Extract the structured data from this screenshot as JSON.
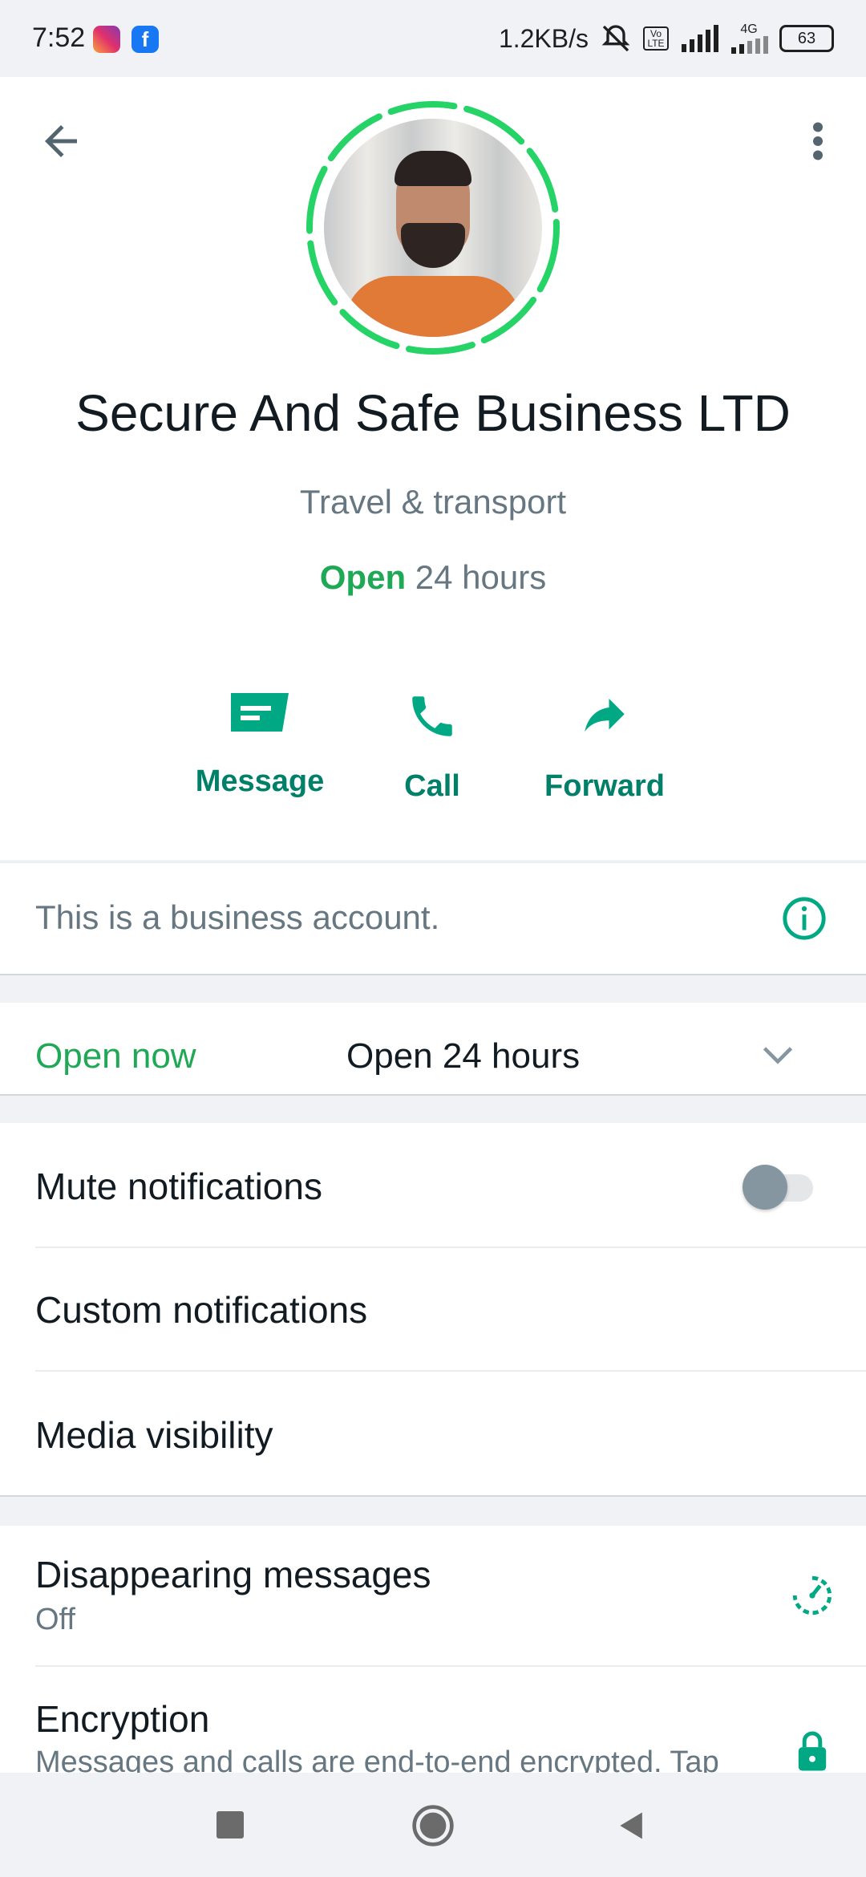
{
  "status_bar": {
    "time": "7:52",
    "net_speed": "1.2KB/s",
    "network": "4G",
    "volte": "Vo LTE",
    "battery": "63"
  },
  "profile": {
    "name": "Secure And Safe Business LTD",
    "category": "Travel & transport",
    "hours_status": "Open",
    "hours_detail": "24 hours"
  },
  "actions": [
    {
      "label": "Message",
      "icon": "message-icon"
    },
    {
      "label": "Call",
      "icon": "call-icon"
    },
    {
      "label": "Forward",
      "icon": "forward-icon"
    }
  ],
  "business_notice": "This is a business account.",
  "hours_row": {
    "status": "Open now",
    "detail": "Open 24 hours"
  },
  "settings": {
    "mute": {
      "label": "Mute notifications",
      "enabled": false
    },
    "custom": "Custom notifications",
    "media": "Media visibility"
  },
  "privacy": {
    "disappearing": {
      "label": "Disappearing messages",
      "value": "Off"
    },
    "encryption": {
      "label": "Encryption",
      "desc": "Messages and calls are end-to-end encrypted. Tap"
    }
  },
  "colors": {
    "accent": "#008069",
    "green": "#1fa855",
    "status_ring": "#25d366"
  }
}
